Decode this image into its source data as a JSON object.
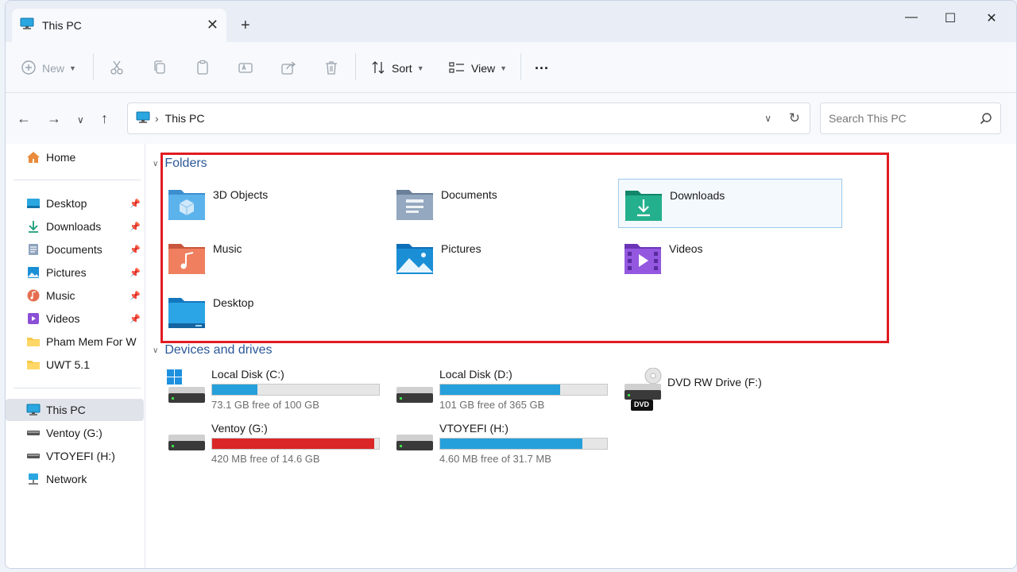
{
  "window": {
    "tab_title": "This PC",
    "new_tab": "+",
    "minimize": "—",
    "maximize": "☐",
    "close": "✕"
  },
  "toolbar": {
    "new_label": "New",
    "sort_label": "Sort",
    "view_label": "View",
    "more_label": "···"
  },
  "address": {
    "path": "This PC",
    "search_placeholder": "Search This PC"
  },
  "sidebar": {
    "home": "Home",
    "pinned": [
      {
        "label": "Desktop",
        "icon": "desktop-icon"
      },
      {
        "label": "Downloads",
        "icon": "downloads-icon"
      },
      {
        "label": "Documents",
        "icon": "documents-icon"
      },
      {
        "label": "Pictures",
        "icon": "pictures-icon"
      },
      {
        "label": "Music",
        "icon": "music-icon"
      },
      {
        "label": "Videos",
        "icon": "videos-icon"
      }
    ],
    "folders": [
      {
        "label": "Pham Mem For W"
      },
      {
        "label": "UWT 5.1"
      }
    ],
    "this_pc": "This PC",
    "drives": [
      {
        "label": "Ventoy (G:)"
      },
      {
        "label": "VTOYEFI (H:)"
      }
    ],
    "network": "Network"
  },
  "content": {
    "folders_title": "Folders",
    "folders": [
      {
        "name": "3D Objects",
        "icon": "3d-objects-folder-icon"
      },
      {
        "name": "Documents",
        "icon": "documents-folder-icon"
      },
      {
        "name": "Downloads",
        "icon": "downloads-folder-icon"
      },
      {
        "name": "Music",
        "icon": "music-folder-icon"
      },
      {
        "name": "Pictures",
        "icon": "pictures-folder-icon"
      },
      {
        "name": "Videos",
        "icon": "videos-folder-icon"
      },
      {
        "name": "Desktop",
        "icon": "desktop-folder-icon"
      }
    ],
    "drives_title": "Devices and drives",
    "drives": [
      {
        "name": "Local Disk (C:)",
        "free": "73.1 GB free of 100 GB",
        "used_fraction": 0.27,
        "color": "#26a0da"
      },
      {
        "name": "Local Disk (D:)",
        "free": "101 GB free of 365 GB",
        "used_fraction": 0.72,
        "color": "#26a0da"
      },
      {
        "name": "DVD RW Drive (F:)",
        "dvd_label": "DVD"
      },
      {
        "name": "Ventoy (G:)",
        "free": "420 MB free of 14.6 GB",
        "used_fraction": 0.97,
        "color": "#da2626"
      },
      {
        "name": "VTOYEFI (H:)",
        "free": "4.60 MB free of 31.7 MB",
        "used_fraction": 0.85,
        "color": "#26a0da"
      }
    ]
  },
  "colors": {
    "accent": "#26a0da",
    "warning": "#da2626",
    "highlight_box": "#e11b22",
    "section_title": "#2b5797"
  }
}
